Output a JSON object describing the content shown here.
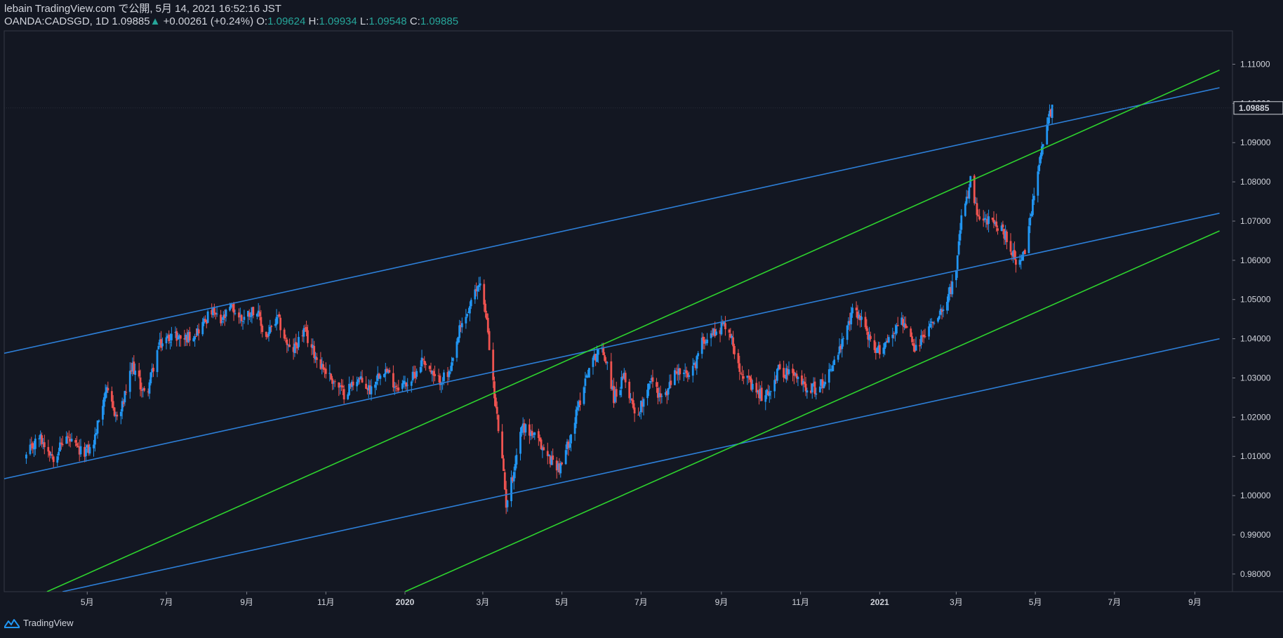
{
  "header": {
    "publish_line": "lebain TradingView.com で公開, 5月 14, 2021 16:52:16 JST",
    "symbol": "OANDA:CADSGD, 1D",
    "last": "1.09885",
    "arrow": "▲",
    "change": "+0.00261 (+0.24%)",
    "o_label": "O:",
    "o_value": "1.09624",
    "h_label": "H:",
    "h_value": "1.09934",
    "l_label": "L:",
    "l_value": "1.09548",
    "c_label": "C:",
    "c_value": "1.09885"
  },
  "footer": {
    "brand": "TradingView",
    "logo_icon": "tradingview-logo-icon"
  },
  "colors": {
    "background": "#131722",
    "up": "#2196f3",
    "down": "#ef5350",
    "channel_blue": "#2d7fd8",
    "channel_green": "#2ed32e",
    "text": "#d1d4dc",
    "price_label_bg": "#131722"
  },
  "chart_data": {
    "type": "candlestick",
    "symbol": "OANDA:CADSGD",
    "interval": "1D",
    "ylim": [
      0.9755,
      1.1185
    ],
    "y_ticks": [
      "1.11000",
      "1.10000",
      "1.09000",
      "1.08000",
      "1.07000",
      "1.06000",
      "1.05000",
      "1.04000",
      "1.03000",
      "1.02000",
      "1.01000",
      "1.00000",
      "0.99000",
      "0.98000"
    ],
    "x_ticks": [
      {
        "label": "5月",
        "bold": false,
        "date": "2019-05-01"
      },
      {
        "label": "7月",
        "bold": false,
        "date": "2019-07-01"
      },
      {
        "label": "9月",
        "bold": false,
        "date": "2019-09-01"
      },
      {
        "label": "11月",
        "bold": false,
        "date": "2019-11-01"
      },
      {
        "label": "2020",
        "bold": true,
        "date": "2020-01-01"
      },
      {
        "label": "3月",
        "bold": false,
        "date": "2020-03-01"
      },
      {
        "label": "5月",
        "bold": false,
        "date": "2020-05-01"
      },
      {
        "label": "7月",
        "bold": false,
        "date": "2020-07-01"
      },
      {
        "label": "9月",
        "bold": false,
        "date": "2020-09-01"
      },
      {
        "label": "11月",
        "bold": false,
        "date": "2020-11-01"
      },
      {
        "label": "2021",
        "bold": true,
        "date": "2021-01-01"
      },
      {
        "label": "3月",
        "bold": false,
        "date": "2021-03-01"
      },
      {
        "label": "5月",
        "bold": false,
        "date": "2021-05-01"
      },
      {
        "label": "7月",
        "bold": false,
        "date": "2021-07-01"
      },
      {
        "label": "9月",
        "bold": false,
        "date": "2021-09-01"
      }
    ],
    "current_price": "1.09885",
    "close_series": {
      "dates": [
        "2019-03-15",
        "2019-03-25",
        "2019-04-05",
        "2019-04-15",
        "2019-04-25",
        "2019-05-05",
        "2019-05-15",
        "2019-05-25",
        "2019-06-05",
        "2019-06-15",
        "2019-06-25",
        "2019-07-05",
        "2019-07-15",
        "2019-07-25",
        "2019-08-05",
        "2019-08-12",
        "2019-08-20",
        "2019-08-28",
        "2019-09-08",
        "2019-09-15",
        "2019-09-25",
        "2019-10-05",
        "2019-10-15",
        "2019-10-25",
        "2019-11-05",
        "2019-11-15",
        "2019-11-25",
        "2019-12-05",
        "2019-12-15",
        "2019-12-25",
        "2020-01-05",
        "2020-01-15",
        "2020-01-25",
        "2020-02-05",
        "2020-02-12",
        "2020-02-20",
        "2020-02-28",
        "2020-03-05",
        "2020-03-10",
        "2020-03-15",
        "2020-03-19",
        "2020-03-24",
        "2020-03-31",
        "2020-04-10",
        "2020-04-20",
        "2020-04-30",
        "2020-05-10",
        "2020-05-20",
        "2020-05-30",
        "2020-06-05",
        "2020-06-10",
        "2020-06-18",
        "2020-06-28",
        "2020-07-08",
        "2020-07-18",
        "2020-07-28",
        "2020-08-08",
        "2020-08-18",
        "2020-08-28",
        "2020-09-05",
        "2020-09-15",
        "2020-09-25",
        "2020-10-05",
        "2020-10-15",
        "2020-10-25",
        "2020-11-05",
        "2020-11-15",
        "2020-11-25",
        "2020-12-05",
        "2020-12-12",
        "2020-12-20",
        "2020-12-28",
        "2021-01-08",
        "2021-01-18",
        "2021-01-28",
        "2021-02-08",
        "2021-02-18",
        "2021-02-28",
        "2021-03-05",
        "2021-03-12",
        "2021-03-18",
        "2021-03-25",
        "2021-04-02",
        "2021-04-10",
        "2021-04-18",
        "2021-04-23",
        "2021-04-28",
        "2021-05-04",
        "2021-05-09",
        "2021-05-14"
      ],
      "close": [
        1.01,
        1.015,
        1.01,
        1.015,
        1.011,
        1.012,
        1.027,
        1.019,
        1.033,
        1.025,
        1.038,
        1.041,
        1.04,
        1.042,
        1.047,
        1.044,
        1.048,
        1.045,
        1.048,
        1.04,
        1.045,
        1.036,
        1.042,
        1.035,
        1.03,
        1.026,
        1.03,
        1.027,
        1.033,
        1.028,
        1.029,
        1.035,
        1.029,
        1.031,
        1.042,
        1.048,
        1.055,
        1.042,
        1.025,
        1.012,
        0.998,
        1.005,
        1.018,
        1.015,
        1.01,
        1.007,
        1.018,
        1.031,
        1.038,
        1.034,
        1.025,
        1.03,
        1.02,
        1.03,
        1.024,
        1.032,
        1.03,
        1.04,
        1.042,
        1.044,
        1.033,
        1.027,
        1.025,
        1.032,
        1.031,
        1.028,
        1.027,
        1.033,
        1.04,
        1.048,
        1.044,
        1.036,
        1.04,
        1.045,
        1.037,
        1.043,
        1.048,
        1.055,
        1.07,
        1.08,
        1.07,
        1.07,
        1.069,
        1.065,
        1.058,
        1.062,
        1.072,
        1.085,
        1.095,
        1.0988
      ]
    },
    "trendlines": [
      {
        "color": "blue",
        "from": {
          "date": "2019-02-15",
          "value": 1.0355
        },
        "to": {
          "date": "2021-09-20",
          "value": 1.104
        }
      },
      {
        "color": "blue",
        "from": {
          "date": "2019-02-15",
          "value": 1.0035
        },
        "to": {
          "date": "2021-09-20",
          "value": 1.072
        }
      },
      {
        "color": "blue",
        "from": {
          "date": "2019-04-12",
          "value": 0.9755
        },
        "to": {
          "date": "2021-09-20",
          "value": 1.04
        }
      },
      {
        "color": "green",
        "from": {
          "date": "2019-03-31",
          "value": 0.9755
        },
        "to": {
          "date": "2021-09-20",
          "value": 1.1085
        }
      },
      {
        "color": "green",
        "from": {
          "date": "2020-01-01",
          "value": 0.9755
        },
        "to": {
          "date": "2021-09-20",
          "value": 1.0675
        }
      }
    ]
  }
}
